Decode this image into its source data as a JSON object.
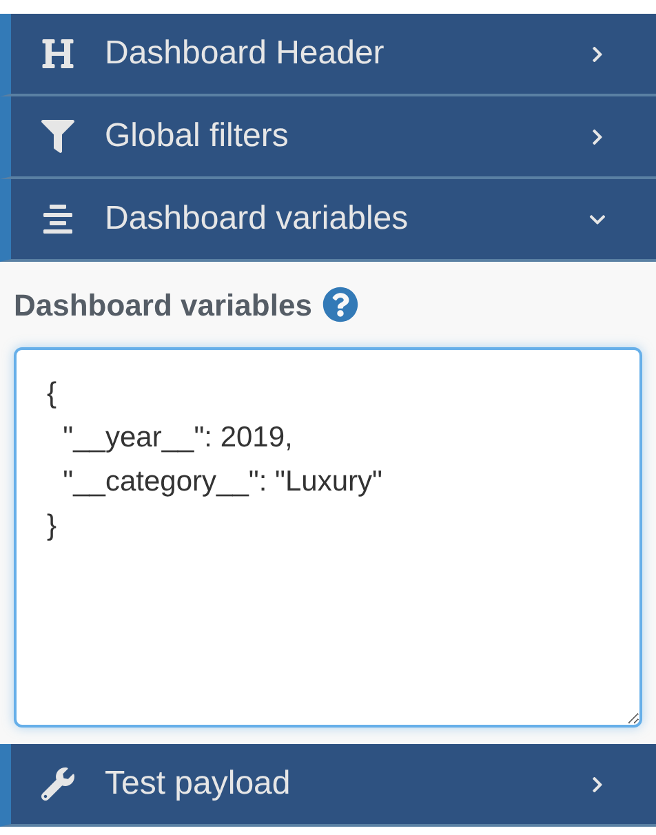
{
  "sections": [
    {
      "label": "Dashboard Header",
      "expanded": false
    },
    {
      "label": "Global filters",
      "expanded": false
    },
    {
      "label": "Dashboard variables",
      "expanded": true,
      "panel": {
        "label": "Dashboard variables",
        "value": "{\n  \"__year__\": 2019,\n  \"__category__\": \"Luxury\"\n}"
      }
    },
    {
      "label": "Test payload",
      "expanded": false
    }
  ]
}
